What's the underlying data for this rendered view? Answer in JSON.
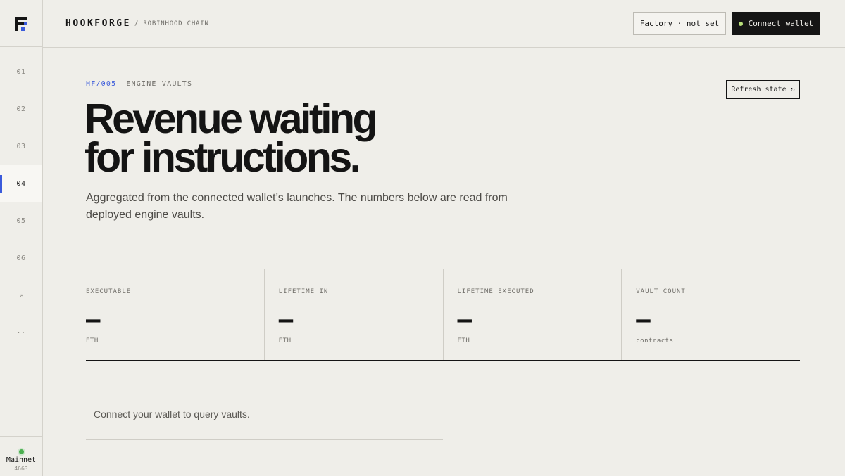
{
  "brand": {
    "name": "HOOKFORGE",
    "chain": "/ ROBINHOOD CHAIN"
  },
  "nav": {
    "items": [
      {
        "label": "01"
      },
      {
        "label": "02"
      },
      {
        "label": "03"
      },
      {
        "label": "04",
        "active": true
      },
      {
        "label": "05"
      },
      {
        "label": "06"
      },
      {
        "label": "↗"
      },
      {
        "label": "··"
      }
    ]
  },
  "network": {
    "name": "Mainnet",
    "chain_id": "4663",
    "status_color": "#4caf50"
  },
  "header": {
    "factory_label": "Factory · not set",
    "connect_label": "Connect wallet"
  },
  "section": {
    "code": "HF/005",
    "name": "ENGINE VAULTS",
    "refresh_label": "Refresh state ↻",
    "headline_line1": "Revenue waiting",
    "headline_line2": "for instructions.",
    "lede": "Aggregated from the connected wallet’s launches. The numbers below are read from deployed engine vaults."
  },
  "stats": [
    {
      "label": "EXECUTABLE",
      "value": "—",
      "unit": "ETH"
    },
    {
      "label": "LIFETIME IN",
      "value": "—",
      "unit": "ETH"
    },
    {
      "label": "LIFETIME EXECUTED",
      "value": "—",
      "unit": "ETH"
    },
    {
      "label": "VAULT COUNT",
      "value": "—",
      "unit": "contracts"
    }
  ],
  "notice": "Connect your wallet to query vaults.",
  "colors": {
    "accent": "#3b5bdb",
    "background": "#efeee9",
    "ink": "#141414"
  }
}
